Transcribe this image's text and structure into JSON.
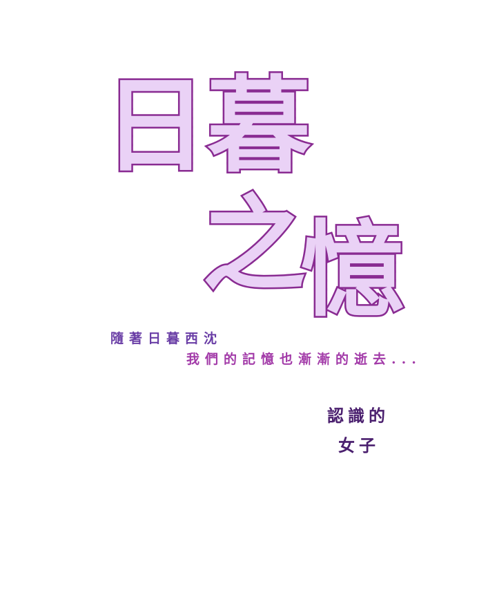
{
  "title": {
    "chars": [
      "日",
      "暮",
      "之",
      "憶"
    ]
  },
  "subtitle": {
    "line1": "隨著日暮西沈",
    "line2": "我們的記憶也漸漸的逝去..."
  },
  "footer": {
    "line1": "認識的",
    "line2": "女子"
  },
  "colors": {
    "title_fill": "#ead2f6",
    "title_stroke": "#8a2c92",
    "subtitle_line1": "#6a3ea6",
    "subtitle_line2": "#a23aa8",
    "footer_text": "#4a1f6e",
    "background": "#ffffff"
  }
}
